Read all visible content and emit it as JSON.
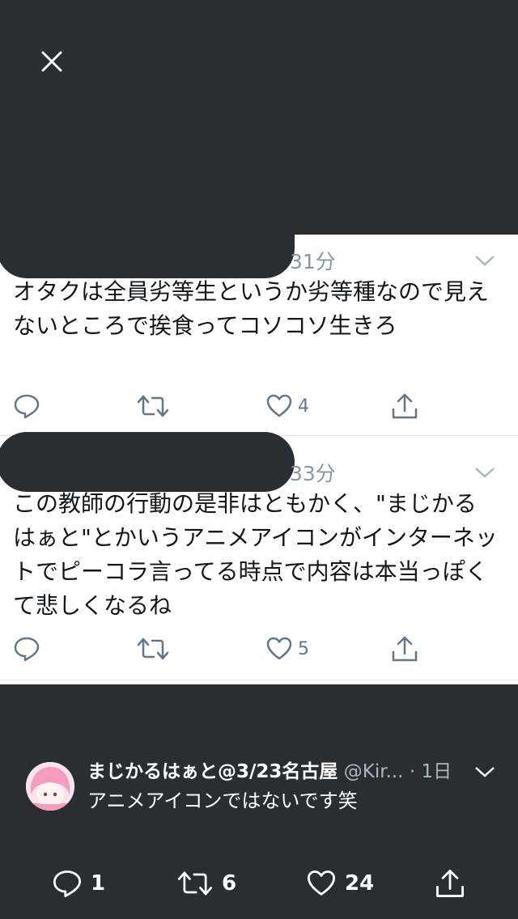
{
  "viewer": {
    "close_icon": "close-icon"
  },
  "tweets": [
    {
      "time": "31分",
      "text": "オタクは全員劣等生というか劣等種なので見えないところで挨食ってコソコソ生きろ",
      "likes": "4"
    },
    {
      "time": "33分",
      "text": "この教師の行動の是非はともかく、\"まじかるはぁと\"とかいうアニメアイコンがインターネットでピーコラ言ってる時点で内容は本当っぽくて悲しくなるね",
      "likes": "5"
    }
  ],
  "caption": {
    "name": "まじかるはぁと@3/23名古屋",
    "handle": "@Kir...",
    "separator": "·",
    "time": "1日",
    "text": "アニメアイコンではないです笑"
  },
  "bottom_actions": {
    "replies": "1",
    "retweets": "6",
    "likes": "24"
  },
  "colors": {
    "background": "#2a2d31",
    "icon_gray": "#657786",
    "meta_gray": "#8899a6"
  }
}
